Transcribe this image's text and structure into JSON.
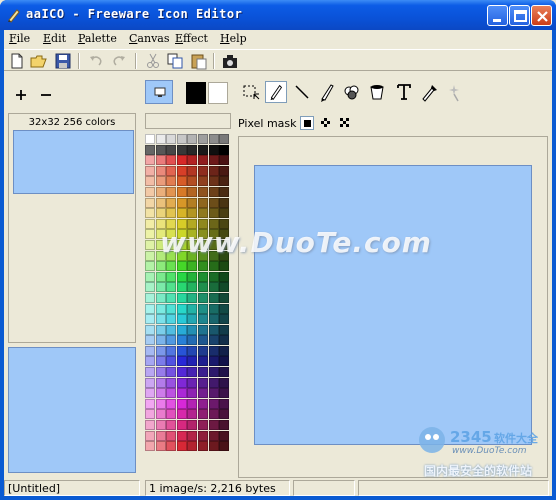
{
  "window": {
    "title": "aaICO - Freeware Icon Editor"
  },
  "menu": {
    "items": [
      "File",
      "Edit",
      "Palette",
      "Canvas",
      "Effect",
      "Help"
    ]
  },
  "toolbar": {
    "icons": [
      "new-file-icon",
      "open-folder-icon",
      "save-icon",
      "undo-icon",
      "redo-icon",
      "cut-icon",
      "copy-icon",
      "paste-icon",
      "camera-icon"
    ]
  },
  "icon_list": {
    "header": "32x32 256 colors"
  },
  "pixel_mask": {
    "label": "Pixel mask"
  },
  "tools": [
    "select-rect-icon",
    "pencil-icon",
    "line-icon",
    "brush-icon",
    "fill-icon",
    "bucket-icon",
    "text-icon",
    "eyedropper-icon",
    "magic-wand-icon"
  ],
  "colors": {
    "current": "#9fc8f8",
    "foreground": "#000000",
    "background": "#ffffff",
    "canvas": "#9fc8f8"
  },
  "status": {
    "file": "[Untitled]",
    "info": "1 image/s: 2,216 bytes"
  },
  "watermark": {
    "main": "www.DuoTe.com",
    "logo_sub1": "www.DuoTe.com",
    "logo_sub2": "国内最安全的软件站"
  }
}
